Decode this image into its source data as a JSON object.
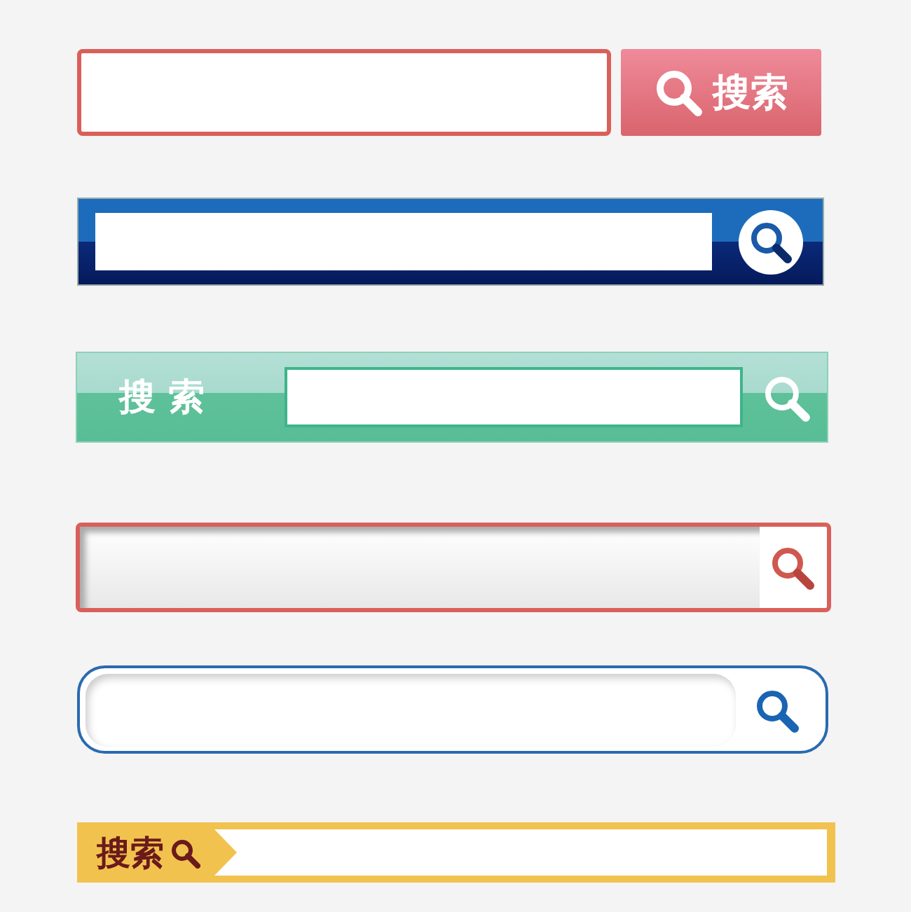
{
  "search_bars": [
    {
      "kind": "pink-button",
      "button_label": "搜索"
    },
    {
      "kind": "navy"
    },
    {
      "kind": "mint",
      "label": "搜 索"
    },
    {
      "kind": "red-inset"
    },
    {
      "kind": "rounded-blue"
    },
    {
      "kind": "yellow-tag",
      "button_label": "搜索"
    }
  ]
}
